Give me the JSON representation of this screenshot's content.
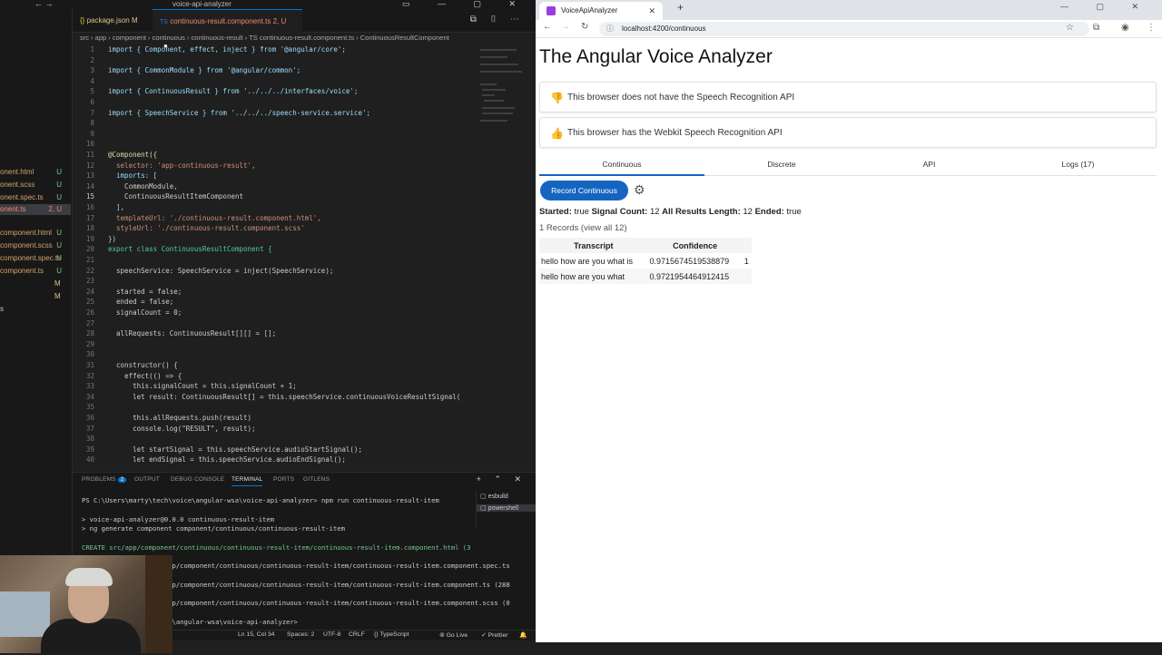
{
  "vscode": {
    "title": "voice-api-analyzer",
    "tabs": [
      {
        "label": "package.json",
        "badge": "M"
      },
      {
        "label": "continuous-result.component.ts",
        "badge": "2, U"
      }
    ],
    "breadcrumb": "src › app › component › continuous › continuous-result › TS continuous-result.component.ts › ContinuousResultComponent",
    "explorer_items": [
      {
        "name": "onent.html",
        "status": "U"
      },
      {
        "name": "onent.scss",
        "status": "U"
      },
      {
        "name": "onent.spec.ts",
        "status": "U"
      },
      {
        "name": "onent.ts",
        "status": "2, U"
      },
      {
        "name": "component.html",
        "status": "U"
      },
      {
        "name": "component.scss",
        "status": "U"
      },
      {
        "name": "component.spec.ts",
        "status": "U"
      },
      {
        "name": "component.ts",
        "status": "U"
      },
      {
        "name": "M",
        "status": ""
      },
      {
        "name": "M",
        "status": ""
      },
      {
        "name": "s",
        "status": ""
      }
    ],
    "code_lines": [
      {
        "n": "1",
        "t": "import { Component, effect, inject } from '@angular/core';"
      },
      {
        "n": "2",
        "t": ""
      },
      {
        "n": "3",
        "t": "import { CommonModule } from '@angular/common';"
      },
      {
        "n": "4",
        "t": ""
      },
      {
        "n": "5",
        "t": "import { ContinuousResult } from '../../../interfaces/voice';"
      },
      {
        "n": "6",
        "t": ""
      },
      {
        "n": "7",
        "t": "import { SpeechService } from '../../../speech-service.service';"
      },
      {
        "n": "8",
        "t": ""
      },
      {
        "n": "9",
        "t": ""
      },
      {
        "n": "10",
        "t": ""
      },
      {
        "n": "11",
        "t": "@Component({"
      },
      {
        "n": "12",
        "t": "  selector: 'app-continuous-result',"
      },
      {
        "n": "13",
        "t": "  imports: ["
      },
      {
        "n": "14",
        "t": "    CommonModule,"
      },
      {
        "n": "15",
        "t": "    ContinuousResultItemComponent"
      },
      {
        "n": "16",
        "t": "  ],"
      },
      {
        "n": "17",
        "t": "  templateUrl: './continuous-result.component.html',"
      },
      {
        "n": "18",
        "t": "  styleUrl: './continuous-result.component.scss'"
      },
      {
        "n": "19",
        "t": "})"
      },
      {
        "n": "20",
        "t": "export class ContinuousResultComponent {"
      },
      {
        "n": "21",
        "t": ""
      },
      {
        "n": "22",
        "t": "  speechService: SpeechService = inject(SpeechService);"
      },
      {
        "n": "23",
        "t": ""
      },
      {
        "n": "24",
        "t": "  started = false;"
      },
      {
        "n": "25",
        "t": "  ended = false;"
      },
      {
        "n": "26",
        "t": "  signalCount = 0;"
      },
      {
        "n": "27",
        "t": ""
      },
      {
        "n": "28",
        "t": "  allRequests: ContinuousResult[][] = [];"
      },
      {
        "n": "29",
        "t": ""
      },
      {
        "n": "30",
        "t": ""
      },
      {
        "n": "31",
        "t": "  constructor() {"
      },
      {
        "n": "32",
        "t": "    effect(() => {"
      },
      {
        "n": "33",
        "t": "      this.signalCount = this.signalCount + 1;"
      },
      {
        "n": "34",
        "t": "      let result: ContinuousResult[] = this.speechService.continuousVoiceResultSignal("
      },
      {
        "n": "35",
        "t": ""
      },
      {
        "n": "36",
        "t": "      this.allRequests.push(result)"
      },
      {
        "n": "37",
        "t": "      console.log(\"RESULT\", result);"
      },
      {
        "n": "38",
        "t": ""
      },
      {
        "n": "39",
        "t": "      let startSignal = this.speechService.audioStartSignal();"
      },
      {
        "n": "40",
        "t": "      let endSignal = this.speechService.audioEndSignal();"
      }
    ],
    "panel_tabs": [
      "PROBLEMS",
      "OUTPUT",
      "DEBUG CONSOLE",
      "TERMINAL",
      "PORTS",
      "GITLENS"
    ],
    "problems_count": "2",
    "terminal_lines": [
      "PS C:\\Users\\marty\\tech\\voice\\angular-wsa\\voice-api-analyzer> npm run continuous-result-item",
      "",
      "> voice-api-analyzer@0.0.0 continuous-result-item",
      "> ng generate component component/continuous/continuous-result-item",
      "",
      "CREATE src/app/component/continuous/continuous-result-item/continuous-result-item.component.html (3",
      "",
      "                 src/app/component/continuous/continuous-result-item/continuous-result-item.component.spec.ts",
      "",
      "                 src/app/component/continuous/continuous-result-item/continuous-result-item.component.ts (288",
      "",
      "                 src/app/component/continuous/continuous-result-item/continuous-result-item.component.scss (0",
      "",
      "                 \\voice\\angular-wsa\\voice-api-analyzer> "
    ],
    "terminal_list": [
      "esbuild",
      "powershell"
    ],
    "status": {
      "position": "Ln 15, Col 34",
      "spaces": "Spaces: 2",
      "encoding": "UTF-8",
      "eol": "CRLF",
      "language": "TypeScript",
      "golive": "Go Live",
      "prettier": "Prettier"
    }
  },
  "browser": {
    "tab_title": "VoiceApiAnalyzer",
    "url": "localhost:4200/continuous",
    "page_title": "The Angular Voice Analyzer",
    "alerts": [
      {
        "text": "This browser does not have the Speech Recognition API",
        "icon": "thumbs-down-icon",
        "color": "#c62828"
      },
      {
        "text": "This browser has the Webkit Speech Recognition API",
        "icon": "thumbs-up-icon",
        "color": "#2e7d32"
      }
    ],
    "tabs": [
      "Continuous",
      "Discrete",
      "API",
      "Logs (17)"
    ],
    "record_button": "Record Continuous",
    "stats": {
      "started_label": "Started:",
      "started_value": "true",
      "signal_label": "Signal Count:",
      "signal_value": "12",
      "length_label": "All Results Length:",
      "length_value": "12",
      "ended_label": "Ended:",
      "ended_value": "true"
    },
    "records_text": "1 Records (view all 12)",
    "table": {
      "headers": [
        "Transcript",
        "Confidence"
      ],
      "rows": [
        {
          "transcript": "hello how are you what is",
          "confidence": "0.9715674519538879",
          "extra": "1"
        },
        {
          "transcript": "hello how are you what",
          "confidence": "0.9721954464912415",
          "extra": ""
        }
      ]
    },
    "accent_color": "#1565c0"
  }
}
